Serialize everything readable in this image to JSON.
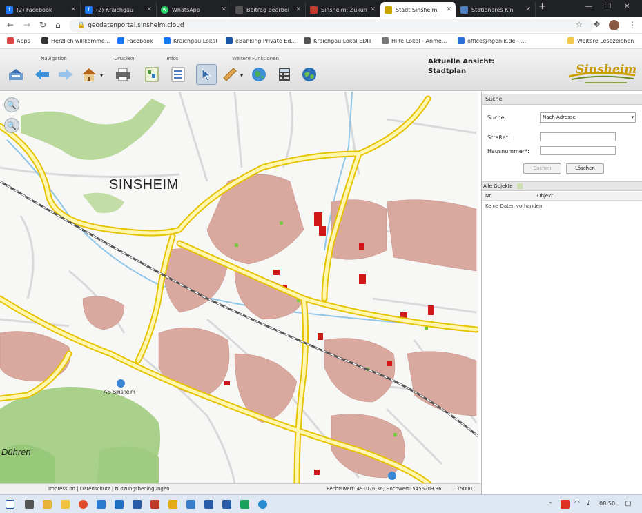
{
  "browser": {
    "tabs": [
      {
        "label": "(2) Facebook",
        "color": "#1877f2",
        "glyph": "f"
      },
      {
        "label": "(2) Kraichgau",
        "color": "#1877f2",
        "glyph": "f"
      },
      {
        "label": "WhatsApp",
        "color": "#25d366",
        "glyph": "w"
      },
      {
        "label": "Beitrag bearbei",
        "color": "#555555",
        "glyph": "b"
      },
      {
        "label": "Sinsheim: Zukun",
        "color": "#c0392b",
        "glyph": "s"
      },
      {
        "label": "Stadt Sinsheim",
        "color": "#caa400",
        "glyph": "s"
      },
      {
        "label": "Stationäres Kin",
        "color": "#4a7cc0",
        "glyph": "k"
      }
    ],
    "new_tab": "+",
    "url": "geodatenportal.sinsheim.cloud",
    "bookmarks": [
      {
        "label": "Apps",
        "color": "#d44"
      },
      {
        "label": "Herzlich willkomme...",
        "color": "#333"
      },
      {
        "label": "Facebook",
        "color": "#1877f2"
      },
      {
        "label": "Kraichgau Lokal",
        "color": "#1877f2"
      },
      {
        "label": "eBanking Private Ed...",
        "color": "#1a56a8"
      },
      {
        "label": "Kraichgau Lokal EDIT",
        "color": "#555"
      },
      {
        "label": "Hilfe Lokal - Anme...",
        "color": "#777"
      },
      {
        "label": "office@hgenik.de - ...",
        "color": "#2a6fd6"
      },
      {
        "label": "Weitere Lesezeichen",
        "color": "#f2c94c"
      }
    ]
  },
  "toolbar": {
    "groups": {
      "navigation": "Navigation",
      "drucken": "Drucken",
      "infos": "Infos",
      "weitere": "Weitere Funktionen"
    },
    "view_label": "Aktuelle Ansicht:",
    "view_name": "Stadtplan",
    "logo_text": "Sinsheim"
  },
  "map": {
    "city_label": "SINSHEIM",
    "district_label": "Dühren",
    "station_label": "AS Sinsheim",
    "status_left": "Impressum | Datenschutz | Nutzungsbedingungen",
    "status_right": "Rechtswert: 491076.36; Hochwert: 5456209.36",
    "scale": "1:15000"
  },
  "panel": {
    "search_header": "Suche",
    "suche_label": "Suche:",
    "suche_value": "Nach Adresse",
    "strasse_label": "Straße*:",
    "hausnummer_label": "Hausnummer*:",
    "suchen_button": "Suchen",
    "loeschen_button": "Löschen",
    "objects_header": "Alle Objekte",
    "col_nr": "Nr.",
    "col_objekt": "Objekt",
    "empty_text": "Keine Daten vorhanden"
  },
  "taskbar": {
    "time": "08:50"
  }
}
